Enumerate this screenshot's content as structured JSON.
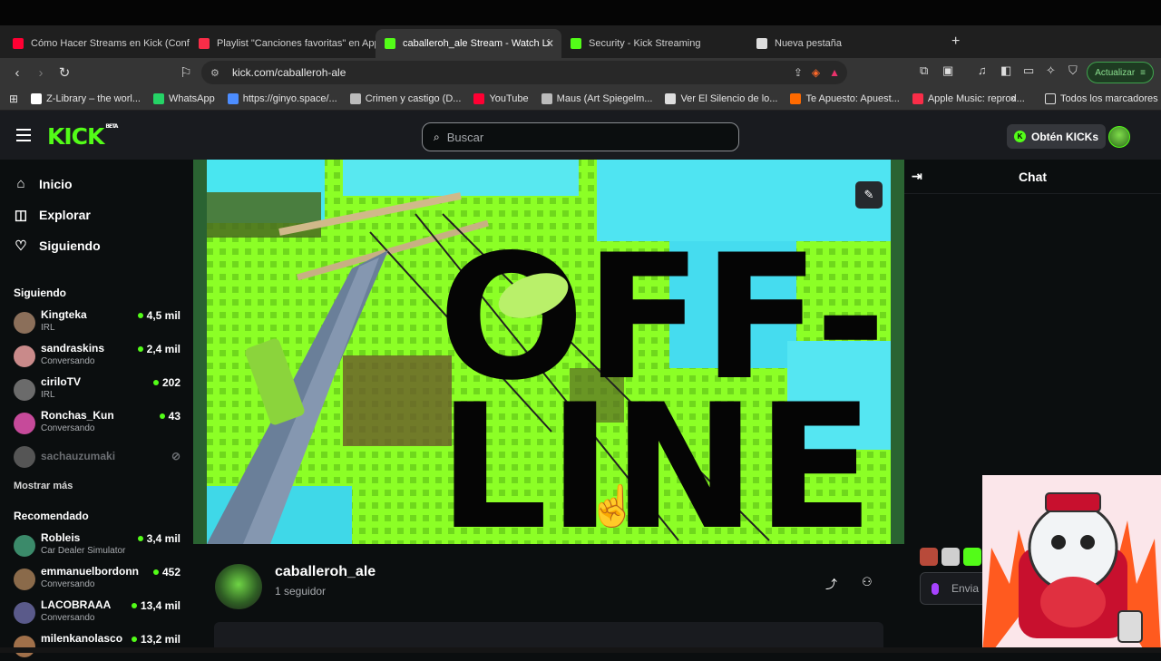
{
  "browser": {
    "tabs": [
      {
        "title": "Cómo Hacer Streams en Kick (Config",
        "icon": "youtube-icon",
        "color": "#ff0033"
      },
      {
        "title": "Playlist \"Canciones favoritas\" en Appl",
        "icon": "apple-music-icon",
        "color": "#fa2d48"
      },
      {
        "title": "caballeroh_ale Stream - Watch Li",
        "icon": "kick-icon",
        "color": "#53fc18",
        "active": true
      },
      {
        "title": "Security - Kick Streaming",
        "icon": "kick-icon",
        "color": "#53fc18"
      },
      {
        "title": "Nueva pestaña",
        "icon": "brave-shield-icon",
        "color": "#dddddd"
      }
    ],
    "url": "kick.com/caballeroh-ale",
    "update_label": "Actualizar",
    "bookmarks": [
      {
        "label": "Z-Library – the worl...",
        "icon": "zlibrary-icon",
        "color": "#ffffff"
      },
      {
        "label": "WhatsApp",
        "icon": "whatsapp-icon",
        "color": "#25d366"
      },
      {
        "label": "https://ginyo.space/...",
        "icon": "link-icon",
        "color": "#4c8dff"
      },
      {
        "label": "Crimen y castigo (D...",
        "icon": "globe-icon",
        "color": "#bbbbbb"
      },
      {
        "label": "YouTube",
        "icon": "youtube-icon",
        "color": "#ff0033"
      },
      {
        "label": "Maus (Art Spiegelm...",
        "icon": "globe-icon",
        "color": "#bbbbbb"
      },
      {
        "label": "Ver El Silencio de lo...",
        "icon": "grid-icon",
        "color": "#dddddd"
      },
      {
        "label": "Te Apuesto: Apuest...",
        "icon": "ta-icon",
        "color": "#ff6a00"
      },
      {
        "label": "Apple Music: reprod...",
        "icon": "apple-music-icon",
        "color": "#fa2d48"
      }
    ],
    "all_bookmarks_label": "Todos los marcadores"
  },
  "site": {
    "logo": "KICK",
    "logo_badge": "BETA",
    "search_placeholder": "Buscar",
    "get_kicks_label": "Obtén KICKs",
    "nav": [
      {
        "label": "Inicio",
        "icon": "home-icon"
      },
      {
        "label": "Explorar",
        "icon": "explore-icon"
      },
      {
        "label": "Siguiendo",
        "icon": "heart-icon"
      }
    ],
    "following_header": "Siguiendo",
    "following": [
      {
        "name": "Kingteka",
        "category": "IRL",
        "viewers": "4,5 mil",
        "live": true,
        "color": "#8b6f5a"
      },
      {
        "name": "sandraskins",
        "category": "Conversando",
        "viewers": "2,4 mil",
        "live": true,
        "color": "#c98a8a"
      },
      {
        "name": "ciriloTV",
        "category": "IRL",
        "viewers": "202",
        "live": true,
        "color": "#6b6b6b"
      },
      {
        "name": "Ronchas_Kun",
        "category": "Conversando",
        "viewers": "43",
        "live": true,
        "color": "#c64a9a"
      },
      {
        "name": "sachauzumaki",
        "category": "",
        "viewers": "",
        "live": false,
        "color": "#555555"
      }
    ],
    "show_more": "Mostrar más",
    "recommended_header": "Recomendado",
    "recommended": [
      {
        "name": "Robleis",
        "category": "Car Dealer Simulator",
        "viewers": "3,4 mil",
        "color": "#3b8a6a"
      },
      {
        "name": "emmanuelbordonn",
        "category": "Conversando",
        "viewers": "452",
        "color": "#8a6a4a"
      },
      {
        "name": "LACOBRAAA",
        "category": "Conversando",
        "viewers": "13,4 mil",
        "color": "#5a5a8a"
      },
      {
        "name": "milenkanolasco",
        "category": "",
        "viewers": "13,2 mil",
        "color": "#a0704a"
      }
    ],
    "offline_text": {
      "line1": "OFF-",
      "line2": "LINE"
    },
    "chat_title": "Chat",
    "chat_input_placeholder": "Envia",
    "channel": {
      "name": "caballeroh_ale",
      "followers": "1 seguidor"
    }
  },
  "colors": {
    "brand": "#53fc18",
    "bg": "#0b0e0f",
    "panel": "#191b1f"
  }
}
